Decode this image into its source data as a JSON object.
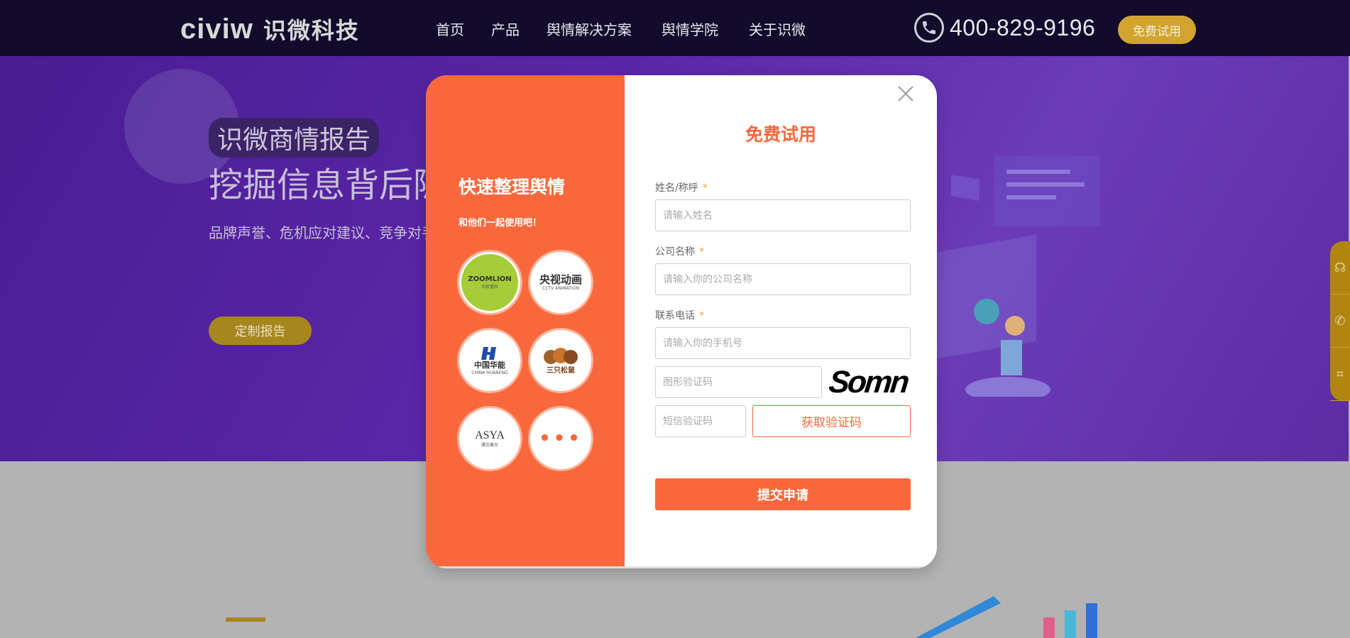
{
  "header": {
    "logo_word": "civiw",
    "logo_cn": "识微科技",
    "nav": [
      "首页",
      "产品",
      "舆情解决方案",
      "舆情学院",
      "关于识微"
    ],
    "phone_icon": "phone-icon",
    "phone": "400-829-9196",
    "trial_label": "免费试用"
  },
  "hero": {
    "tag": "识微商情报告",
    "title": "挖掘信息背后隐",
    "desc": "品牌声誉、危机应对建议、竞争对手",
    "button": "定制报告"
  },
  "side_float": {
    "icons": [
      "headset-icon",
      "phone-icon",
      "gift-icon"
    ]
  },
  "modal": {
    "left": {
      "title": "快速整理舆情",
      "subtitle": "和他们一起使用吧！",
      "brands": [
        {
          "name": "ZOOMLION",
          "sub": "中联重科"
        },
        {
          "name": "央视动画",
          "sub": "CCTV ANIMATION"
        },
        {
          "name": "中国华能",
          "sub": "CHINA HUANENG"
        },
        {
          "name": "三只松鼠",
          "sub": ""
        },
        {
          "name": "ASYA",
          "sub": "雅莎萬兒"
        },
        {
          "name": "•••",
          "sub": ""
        }
      ]
    },
    "right": {
      "title": "免费试用",
      "name_label": "姓名/称呼",
      "name_placeholder": "请输入姓名",
      "company_label": "公司名称",
      "company_placeholder": "请输入你的公司名称",
      "phone_label": "联系电话",
      "phone_placeholder": "请输入你的手机号",
      "required_mark": "*",
      "captcha_placeholder": "图形验证码",
      "captcha_text": "Somn",
      "sms_placeholder": "短信验证码",
      "sms_button": "获取验证码",
      "submit": "提交申请",
      "close_icon": "close-icon"
    }
  },
  "colors": {
    "accent": "#f9683c",
    "header_bg": "#120b2c",
    "gold": "#d2a42f",
    "hero_purple": "#5a26a8"
  }
}
